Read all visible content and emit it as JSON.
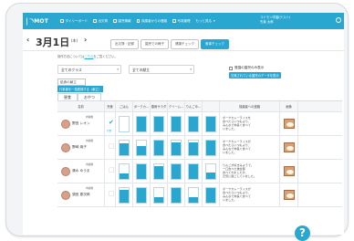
{
  "nav": {
    "logo": "DMOT",
    "items": [
      "ダイリーボード",
      "出欠簿",
      "園児情報",
      "保護者からの連絡",
      "写真管理",
      "もっと見る"
    ],
    "user": [
      "コドモン学園(テスト)",
      "先輩 太郎"
    ],
    "icons": [
      "dashboard-icon",
      "calendar-icon",
      "children-icon",
      "mail-icon",
      "photo-icon",
      "more-icon",
      "gear-icon"
    ]
  },
  "page": {
    "prev": "‹",
    "next": "›",
    "date": "3月1日",
    "weekday": "(木)",
    "tabs": [
      "出欠簿・記録",
      "園児での様子",
      "健康チェック",
      "食事チェック"
    ],
    "active_tab": "食事チェック"
  },
  "controls": {
    "help_text": "操作方法については",
    "help_link": "こちら",
    "help_after": "をご覧ください。",
    "class_select": "全てのクラス",
    "menu_select": "全ての献立",
    "show_only_label": "登園の園児のみ表示",
    "button": "欠席されている園児のデータを表示",
    "memo_label": "給食の献立",
    "add_button": "行事食を一括登録する（献立）",
    "meal_tabs": [
      "昼食",
      "おやつ"
    ]
  },
  "table": {
    "headers": [
      "名前",
      "完食",
      "ごはん",
      "ボークカ…",
      "春雨サラダ",
      "クリーム…",
      "りんごゆ…",
      "",
      "保護者への連絡",
      "画像"
    ],
    "rows": [
      {
        "class": "内容無",
        "name": "野田 レオン",
        "status": "完食",
        "checked": true,
        "levels": [
          0.0,
          1.0,
          1.0,
          1.0,
          1.0,
          1.0
        ],
        "note": "ボークカレーライスを\n食べたらいつもより、\nみんなで仲良く食べて\nいました。",
        "has_photo": true
      },
      {
        "class": "内容無",
        "name": "野崎 焼子",
        "status": "",
        "checked": false,
        "levels": [
          0.8,
          0.6,
          1.0,
          0.85,
          0.9,
          1.0
        ],
        "note": "ボークカレーライスが\n食べたらいつもより、\nみんなで仲良く食べて\nいました。",
        "has_photo": true
      },
      {
        "class": "内容無",
        "name": "清水 ゆうま",
        "status": "",
        "checked": false,
        "levels": [
          0.35,
          1.0,
          0.9,
          1.0,
          1.0,
          0.45
        ],
        "note": "りんごが好きみようで、\n一口食べた後全部\n食べてきましたが、\n元気に過ごしていました。",
        "has_photo": true
      },
      {
        "class": "内容無",
        "name": "須田 恵次郎",
        "status": "",
        "checked": false,
        "levels": [
          0.9,
          1.0,
          0.4,
          1.0,
          0.35,
          1.0
        ],
        "note": "ボークカレーライスが\n食べたらいつもより、\nみんなで仲良く食べて\nいました。",
        "has_photo": true
      }
    ]
  }
}
